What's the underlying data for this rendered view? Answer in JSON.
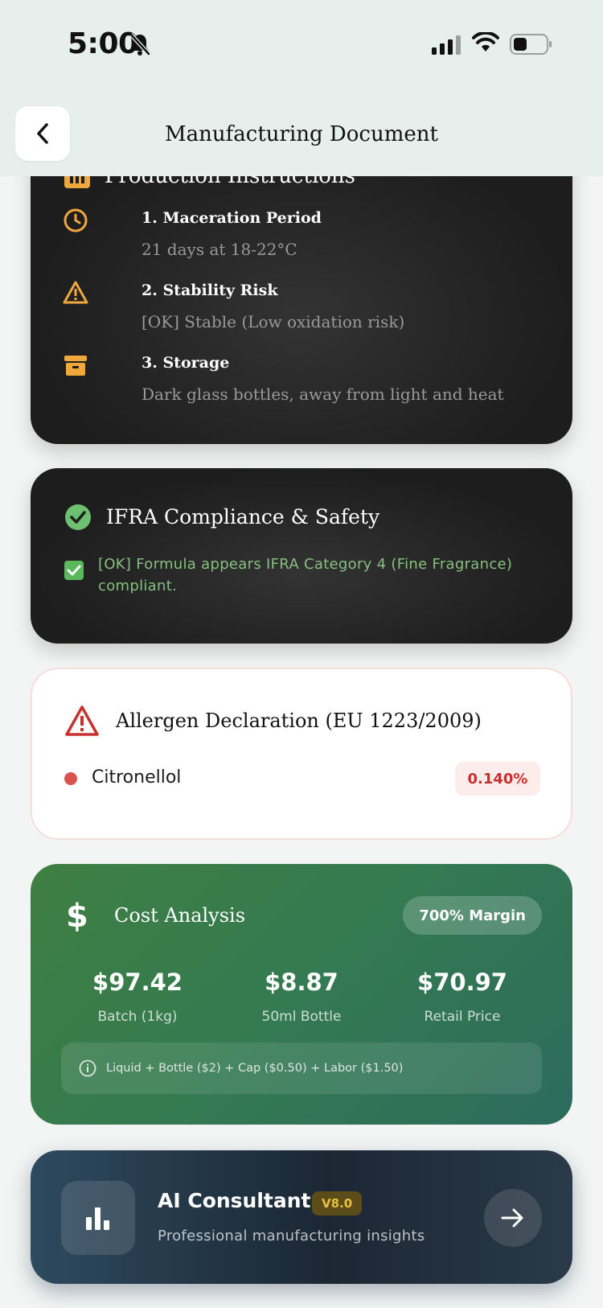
{
  "status_bar": {
    "time": "5:00"
  },
  "header": {
    "title": "Manufacturing Document"
  },
  "production": {
    "title": "Production Instructions",
    "items": [
      {
        "title": "1. Maceration Period",
        "desc": "21 days at 18-22°C",
        "icon": "clock-icon"
      },
      {
        "title": "2. Stability Risk",
        "desc": "[OK] Stable (Low oxidation risk)",
        "icon": "warning-icon"
      },
      {
        "title": "3. Storage",
        "desc": "Dark glass bottles, away from light and heat",
        "icon": "archive-box-icon"
      }
    ]
  },
  "ifra": {
    "title": "IFRA Compliance & Safety",
    "message": "[OK] Formula appears IFRA Category 4 (Fine Fragrance) compliant."
  },
  "allergen": {
    "title": "Allergen Declaration (EU 1223/2009)",
    "items": [
      {
        "name": "Citronellol",
        "percent": "0.140%"
      }
    ]
  },
  "cost": {
    "title": "Cost Analysis",
    "margin": "700% Margin",
    "metrics": [
      {
        "value": "$97.42",
        "label": "Batch (1kg)"
      },
      {
        "value": "$8.87",
        "label": "50ml Bottle"
      },
      {
        "value": "$70.97",
        "label": "Retail Price"
      }
    ],
    "note": "Liquid + Bottle ($2) + Cap ($0.50) + Labor ($1.50)"
  },
  "ai": {
    "title": "AI Consultant",
    "badge": "V8.0",
    "subtitle": "Professional manufacturing insights"
  },
  "colors": {
    "accent_orange": "#f0a83c",
    "success_green": "#6cc070",
    "danger_red": "#c9302c",
    "cost_green": "#3f7f42",
    "ai_navy": "#1b2733"
  }
}
